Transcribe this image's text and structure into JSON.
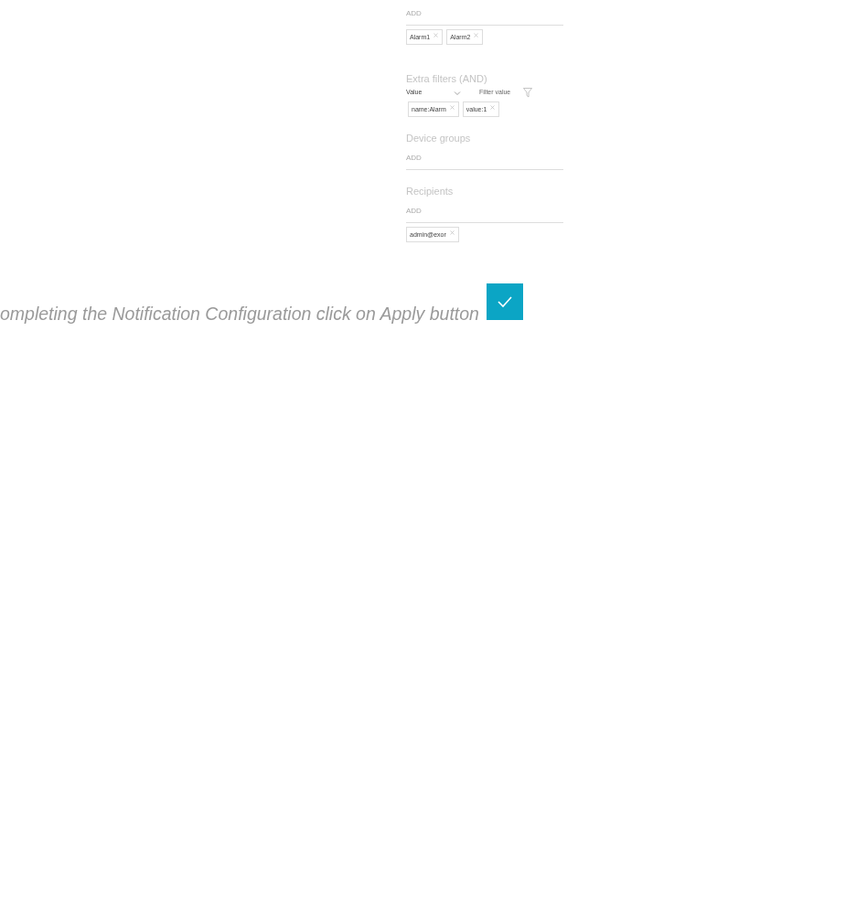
{
  "panel": {
    "sections": [
      {
        "kind": "chips",
        "add_label": "ADD",
        "chips": [
          "Alarm1",
          "Alarm2"
        ]
      },
      {
        "kind": "filters",
        "title": "Extra filters (AND)",
        "select_value": "Value",
        "filter_field": {
          "placeholder": "Filter value"
        },
        "chips": [
          "name:Alarm",
          "value:1"
        ]
      },
      {
        "kind": "chips",
        "title": "Device groups",
        "add_label": "ADD"
      },
      {
        "kind": "chips",
        "title": "Recipients",
        "add_label": "ADD",
        "chips": [
          "admin@exor"
        ]
      }
    ]
  },
  "caption": "ompleting the Notification Configuration click on Apply button"
}
